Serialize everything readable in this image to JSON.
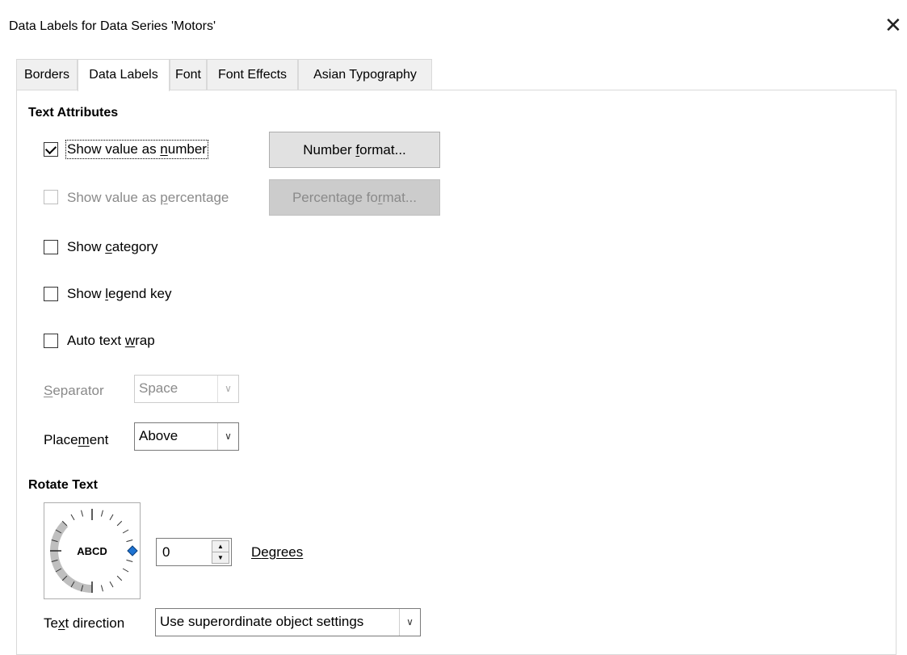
{
  "window": {
    "title": "Data Labels for Data Series 'Motors'"
  },
  "tabs": [
    {
      "label": "Borders"
    },
    {
      "label": "Data Labels"
    },
    {
      "label": "Font"
    },
    {
      "label": "Font Effects"
    },
    {
      "label": "Asian Typography"
    }
  ],
  "active_tab": "Data Labels",
  "text_attributes": {
    "heading": "Text Attributes",
    "show_value_number": {
      "pre": "Show value as ",
      "mn": "n",
      "post": "umber",
      "checked": true
    },
    "show_value_percentage": {
      "pre": "Show value as ",
      "mn": "p",
      "post": "ercentage",
      "checked": false,
      "disabled": true
    },
    "show_category": {
      "pre": "Show ",
      "mn": "c",
      "post": "ategory",
      "checked": false
    },
    "show_legend_key": {
      "pre": "Show ",
      "mn": "l",
      "post": "egend key",
      "checked": false
    },
    "auto_text_wrap": {
      "pre": "Auto text ",
      "mn": "w",
      "post": "rap",
      "checked": false
    },
    "number_format_button": {
      "pre": "Number ",
      "mn": "f",
      "post": "ormat..."
    },
    "percentage_format_button": {
      "pre": "Percentage fo",
      "mn": "r",
      "post": "mat..."
    },
    "separator": {
      "pre": "",
      "mn": "S",
      "post": "eparator",
      "value": "Space",
      "disabled": true
    },
    "placement": {
      "pre": "Place",
      "mn": "m",
      "post": "ent",
      "value": "Above"
    }
  },
  "rotate_text": {
    "heading": "Rotate Text",
    "dial_sample": "ABCD",
    "degrees_value": "0",
    "degrees_label": {
      "pre": "",
      "mn": "D",
      "post": "egrees"
    }
  },
  "text_direction": {
    "label": {
      "pre": "Te",
      "mn": "x",
      "post": "t direction"
    },
    "value": "Use superordinate object settings"
  },
  "icons": [
    "close-icon",
    "checkbox-check-icon",
    "chevron-down-icon",
    "spin-up-icon",
    "spin-down-icon",
    "rotation-dial-icon"
  ],
  "colors": {
    "button_bg": "#e1e1e1",
    "disabled_text": "#8a8a8a",
    "dial_handle": "#1e73d2",
    "panel_border": "#d9d9d9"
  }
}
